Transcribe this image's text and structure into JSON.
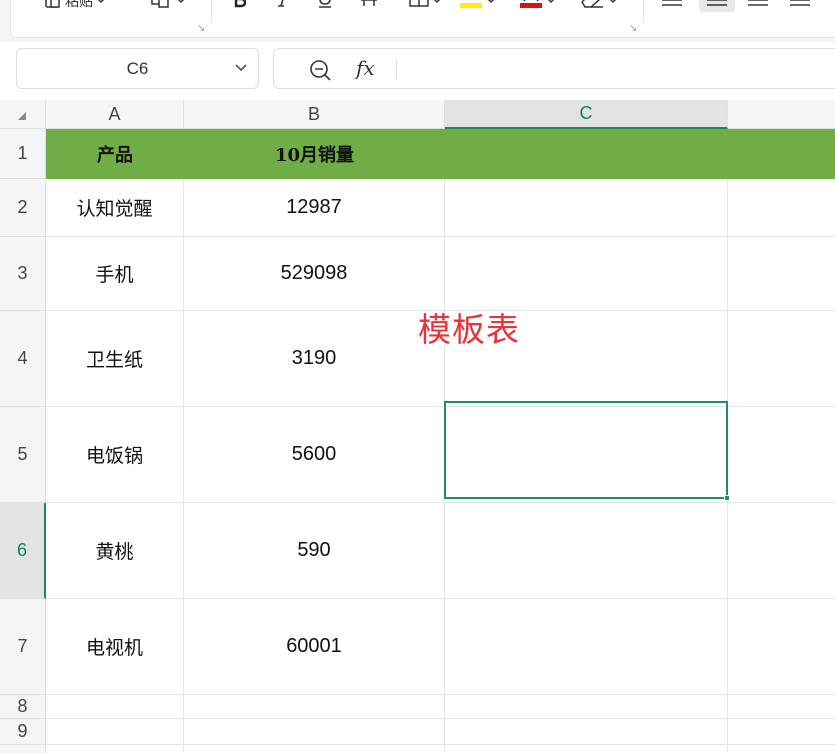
{
  "toolbar": {
    "paste_label": "粘贴"
  },
  "name_box": {
    "value": "C6"
  },
  "formula_bar": {
    "value": "",
    "fx_label": "fx"
  },
  "columns": [
    {
      "label": "A",
      "active": false
    },
    {
      "label": "B",
      "active": false
    },
    {
      "label": "C",
      "active": true
    }
  ],
  "rows": [
    {
      "label": "1",
      "active": false
    },
    {
      "label": "2",
      "active": false
    },
    {
      "label": "3",
      "active": false
    },
    {
      "label": "4",
      "active": false
    },
    {
      "label": "5",
      "active": false
    },
    {
      "label": "6",
      "active": true
    },
    {
      "label": "7",
      "active": false
    },
    {
      "label": "8",
      "active": false
    },
    {
      "label": "9",
      "active": false
    }
  ],
  "table": {
    "header": {
      "product": "产品",
      "sales": "10月销量"
    },
    "rows": [
      {
        "product": "认知觉醒",
        "sales": "12987"
      },
      {
        "product": "手机",
        "sales": "529098"
      },
      {
        "product": "卫生纸",
        "sales": "3190"
      },
      {
        "product": "电饭锅",
        "sales": "5600"
      },
      {
        "product": "黄桃",
        "sales": "590"
      },
      {
        "product": "电视机",
        "sales": "60001"
      }
    ]
  },
  "overlay_text": "模板表",
  "colors": {
    "header_fill": "#70ad47",
    "selection": "#1e8c66",
    "overlay_text": "#e8333a",
    "highlight_yellow": "#ffee00",
    "font_red": "#e01010"
  }
}
